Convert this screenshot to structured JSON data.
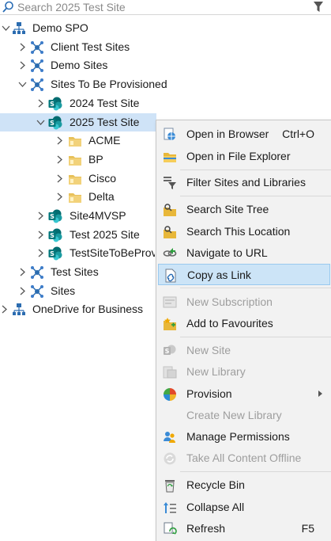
{
  "search": {
    "placeholder": "Search 2025 Test Site"
  },
  "tree": {
    "root": "Demo SPO",
    "client_test_sites": "Client Test Sites",
    "demo_sites": "Demo Sites",
    "sites_to_be_provisioned": "Sites To Be Provisioned",
    "site_2024": "2024 Test Site",
    "site_2025": "2025 Test Site",
    "lib_acme": "ACME",
    "lib_bp": "BP",
    "lib_cisco": "Cisco",
    "lib_delta": "Delta",
    "site4mvsp": "Site4MVSP",
    "test2025site": "Test 2025 Site",
    "testsite_tbp": "TestSiteToBeProv",
    "test_sites": "Test Sites",
    "sites": "Sites",
    "onedrive": "OneDrive for Business"
  },
  "menu": {
    "open_browser": "Open in Browser",
    "open_browser_sc": "Ctrl+O",
    "open_explorer": "Open in File Explorer",
    "filter": "Filter Sites and Libraries",
    "search_tree": "Search Site Tree",
    "search_location": "Search This Location",
    "navigate_url": "Navigate to URL",
    "copy_link": "Copy as Link",
    "new_subscription": "New Subscription",
    "add_favourites": "Add to Favourites",
    "new_site": "New Site",
    "new_library": "New Library",
    "provision": "Provision",
    "create_new_library": "Create New Library",
    "manage_permissions": "Manage Permissions",
    "take_offline": "Take All Content Offline",
    "recycle_bin": "Recycle Bin",
    "collapse_all": "Collapse All",
    "refresh": "Refresh",
    "refresh_sc": "F5"
  },
  "colors": {
    "selection": "#cfe3f7",
    "menu_highlight": "#cce4f7",
    "sharepoint_teal": "#0f7b83",
    "folder_yellow": "#e8c15a",
    "network_blue": "#2b6cb0"
  }
}
